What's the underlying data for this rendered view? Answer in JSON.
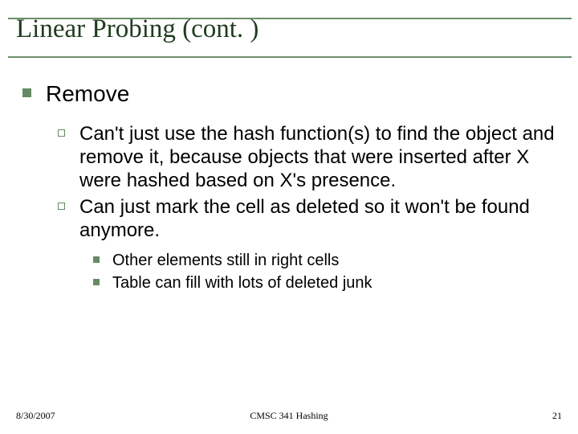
{
  "title": "Linear Probing (cont. )",
  "body": {
    "lvl1": "Remove",
    "lvl2": [
      "Can't just use the hash function(s) to find the object and remove it, because objects that were inserted after X were hashed based on X's presence.",
      "Can just mark the cell as deleted so it won't be found anymore."
    ],
    "lvl3": [
      "Other elements still in right cells",
      "Table can fill with lots of deleted junk"
    ]
  },
  "footer": {
    "date": "8/30/2007",
    "center": "CMSC 341 Hashing",
    "page": "21"
  }
}
